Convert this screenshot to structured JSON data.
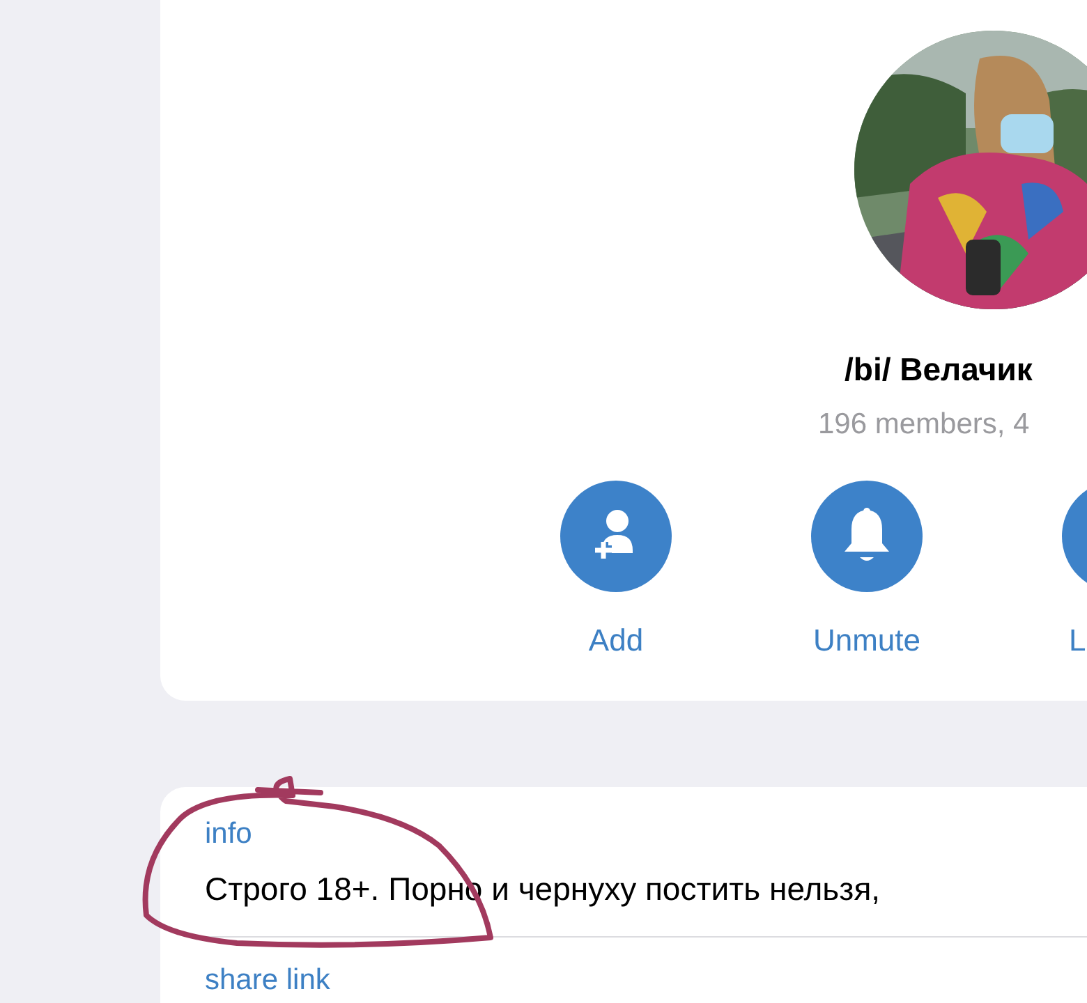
{
  "group": {
    "title": "/bi/ Велачик",
    "subtitle": "196 members, 4"
  },
  "actions": [
    {
      "kind": "add",
      "label": "Add"
    },
    {
      "kind": "unmute",
      "label": "Unmute"
    },
    {
      "kind": "leave",
      "label": "L"
    }
  ],
  "info": {
    "label": "info",
    "text": "Строго 18+. Порно и чернуху постить нельзя,"
  },
  "share_link": {
    "label": "share link"
  }
}
